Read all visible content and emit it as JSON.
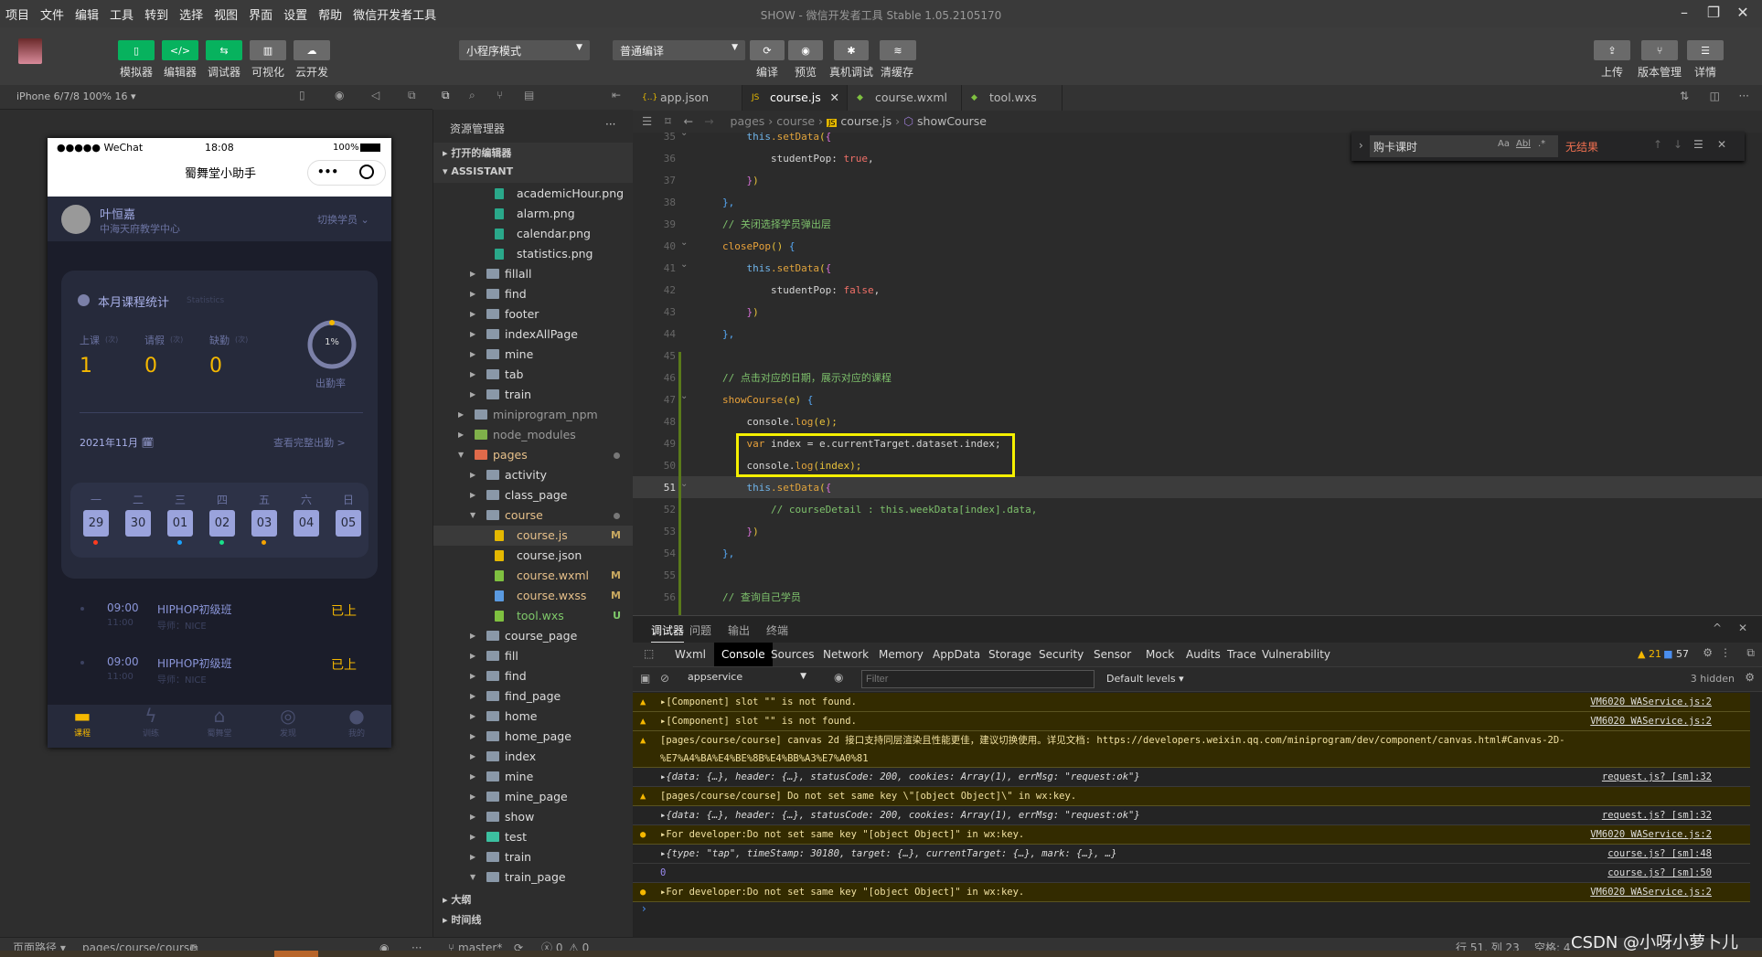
{
  "menu": [
    "项目",
    "文件",
    "编辑",
    "工具",
    "转到",
    "选择",
    "视图",
    "界面",
    "设置",
    "帮助",
    "微信开发者工具"
  ],
  "window_title": "SHOW - 微信开发者工具 Stable 1.05.2105170",
  "toolbar": {
    "left": [
      {
        "label": "模拟器",
        "icon": "phone-icon"
      },
      {
        "label": "编辑器",
        "icon": "code-icon"
      },
      {
        "label": "调试器",
        "icon": "debug-icon"
      },
      {
        "label": "可视化",
        "icon": "layout-icon"
      },
      {
        "label": "云开发",
        "icon": "cloud-icon"
      }
    ],
    "mode_select": "小程序模式",
    "compile_select": "普通编译",
    "mid": [
      {
        "label": "编译",
        "icon": "refresh-icon"
      },
      {
        "label": "预览",
        "icon": "eye-icon"
      },
      {
        "label": "真机调试",
        "icon": "bug-icon"
      },
      {
        "label": "清缓存",
        "icon": "layers-icon"
      }
    ],
    "right": [
      {
        "label": "上传",
        "icon": "upload-icon"
      },
      {
        "label": "版本管理",
        "icon": "branch-icon"
      },
      {
        "label": "详情",
        "icon": "menu-icon"
      }
    ]
  },
  "simulator": {
    "device": "iPhone 6/7/8 100% 16 ▾"
  },
  "phone": {
    "carrier": "●●●●● WeChat",
    "time": "18:08",
    "battery": "100%",
    "app_title": "蜀舞堂小助手",
    "menu_dots": "•••",
    "user": {
      "name": "叶恒嘉",
      "center": "中海天府教学中心",
      "switch": "切换学员"
    },
    "stats": {
      "title": "本月课程统计",
      "subtitle": "Statistics",
      "items": [
        {
          "label": "上课",
          "unit": "(次)",
          "value": "1"
        },
        {
          "label": "请假",
          "unit": "(次)",
          "value": "0"
        },
        {
          "label": "缺勤",
          "unit": "(次)",
          "value": "0"
        }
      ],
      "rate": "1%",
      "rate_label": "出勤率",
      "rate_value": 0.01
    },
    "month": "2021年11月",
    "full_link": "查看完整出勤 >",
    "weekdays": [
      "一",
      "二",
      "三",
      "四",
      "五",
      "六",
      "日"
    ],
    "dates": [
      {
        "d": "29",
        "dot": "#ff3b1f"
      },
      {
        "d": "30",
        "dot": ""
      },
      {
        "d": "01",
        "dot": "#1aa3ff"
      },
      {
        "d": "02",
        "dot": "#19e08a"
      },
      {
        "d": "03",
        "dot": "#f5a300"
      },
      {
        "d": "04",
        "dot": ""
      },
      {
        "d": "05",
        "dot": ""
      }
    ],
    "courses": [
      {
        "start": "09:00",
        "end": "11:00",
        "name": "HIPHOP初级班",
        "teacher": "导师：NICE",
        "status": "已上"
      },
      {
        "start": "09:00",
        "end": "11:00",
        "name": "HIPHOP初级班",
        "teacher": "导师：NICE",
        "status": "已上"
      }
    ],
    "tabbar": [
      "课程",
      "训练",
      "蜀舞堂",
      "发现",
      "我的"
    ]
  },
  "explorer": {
    "title": "资源管理器",
    "more": "···",
    "sections": [
      "打开的编辑器",
      "ASSISTANT"
    ],
    "items": [
      {
        "n": "academicHour.png",
        "l": 3,
        "t": "img"
      },
      {
        "n": "alarm.png",
        "l": 3,
        "t": "img"
      },
      {
        "n": "calendar.png",
        "l": 3,
        "t": "img"
      },
      {
        "n": "statistics.png",
        "l": 3,
        "t": "img"
      },
      {
        "n": "fillall",
        "l": 2,
        "t": "dir"
      },
      {
        "n": "find",
        "l": 2,
        "t": "dir"
      },
      {
        "n": "footer",
        "l": 2,
        "t": "dir"
      },
      {
        "n": "indexAllPage",
        "l": 2,
        "t": "dir"
      },
      {
        "n": "mine",
        "l": 2,
        "t": "dir"
      },
      {
        "n": "tab",
        "l": 2,
        "t": "dir"
      },
      {
        "n": "train",
        "l": 2,
        "t": "dir"
      },
      {
        "n": "miniprogram_npm",
        "l": 1,
        "t": "dir",
        "c": "#999"
      },
      {
        "n": "node_modules",
        "l": 1,
        "t": "npm",
        "c": "#999"
      },
      {
        "n": "pages",
        "l": 1,
        "t": "pages",
        "open": true,
        "c": "#e6c08a",
        "dot": true
      },
      {
        "n": "activity",
        "l": 2,
        "t": "dir"
      },
      {
        "n": "class_page",
        "l": 2,
        "t": "dir"
      },
      {
        "n": "course",
        "l": 2,
        "t": "dir",
        "open": true,
        "c": "#e6c08a",
        "dot": true
      },
      {
        "n": "course.js",
        "l": 3,
        "t": "js",
        "b": "M",
        "c": "#e6c08a",
        "sel": true
      },
      {
        "n": "course.json",
        "l": 3,
        "t": "json"
      },
      {
        "n": "course.wxml",
        "l": 3,
        "t": "wxml",
        "b": "M",
        "c": "#e6c08a"
      },
      {
        "n": "course.wxss",
        "l": 3,
        "t": "wxss",
        "b": "M",
        "c": "#e6c08a"
      },
      {
        "n": "tool.wxs",
        "l": 3,
        "t": "wxs",
        "b": "U",
        "c": "#7fc96a"
      },
      {
        "n": "course_page",
        "l": 2,
        "t": "dir"
      },
      {
        "n": "fill",
        "l": 2,
        "t": "dir"
      },
      {
        "n": "find",
        "l": 2,
        "t": "dir"
      },
      {
        "n": "find_page",
        "l": 2,
        "t": "dir"
      },
      {
        "n": "home",
        "l": 2,
        "t": "dir"
      },
      {
        "n": "home_page",
        "l": 2,
        "t": "dir"
      },
      {
        "n": "index",
        "l": 2,
        "t": "dir"
      },
      {
        "n": "mine",
        "l": 2,
        "t": "dir"
      },
      {
        "n": "mine_page",
        "l": 2,
        "t": "dir"
      },
      {
        "n": "show",
        "l": 2,
        "t": "dir"
      },
      {
        "n": "test",
        "l": 2,
        "t": "test"
      },
      {
        "n": "train",
        "l": 2,
        "t": "dir"
      },
      {
        "n": "train_page",
        "l": 2,
        "t": "dir",
        "open": true
      }
    ],
    "outline": "大纲",
    "timeline": "时间线"
  },
  "tabs": [
    {
      "label": "app.json",
      "icon": "json-icon"
    },
    {
      "label": "course.js",
      "icon": "js-icon",
      "active": true
    },
    {
      "label": "course.wxml",
      "icon": "wxml-icon"
    },
    {
      "label": "tool.wxs",
      "icon": "wxs-icon"
    }
  ],
  "breadcrumb": [
    "pages",
    "course",
    "course.js",
    "showCourse"
  ],
  "find": {
    "query": "购卡课时",
    "opts": [
      "Aa",
      "Abl",
      ".*"
    ],
    "result": "无结果"
  },
  "code": [
    {
      "n": "35",
      "t": [
        [
          "    this",
          "this"
        ],
        [
          ".setData",
          "fn"
        ],
        [
          "(",
          "br2"
        ],
        [
          "{",
          "br"
        ]
      ]
    },
    {
      "n": "36",
      "t": [
        [
          "        studentPop: ",
          "prop"
        ],
        [
          "true",
          "bool"
        ],
        [
          ",",
          "plain"
        ]
      ]
    },
    {
      "n": "37",
      "t": [
        [
          "    ",
          "plain"
        ],
        [
          "}",
          "br"
        ],
        [
          ")",
          "br2"
        ]
      ]
    },
    {
      "n": "38",
      "t": [
        [
          "},",
          "br3"
        ]
      ]
    },
    {
      "n": "39",
      "t": [
        [
          "// 关闭选择学员弹出层",
          "com"
        ]
      ]
    },
    {
      "n": "40",
      "t": [
        [
          "closePop",
          "var"
        ],
        [
          "() ",
          "br2"
        ],
        [
          "{",
          "br3"
        ]
      ]
    },
    {
      "n": "41",
      "t": [
        [
          "    this",
          "this"
        ],
        [
          ".setData",
          "fn"
        ],
        [
          "(",
          "br2"
        ],
        [
          "{",
          "br"
        ]
      ]
    },
    {
      "n": "42",
      "t": [
        [
          "        studentPop: ",
          "prop"
        ],
        [
          "false",
          "bool"
        ],
        [
          ",",
          "plain"
        ]
      ]
    },
    {
      "n": "43",
      "t": [
        [
          "    ",
          "plain"
        ],
        [
          "}",
          "br"
        ],
        [
          ")",
          "br2"
        ]
      ]
    },
    {
      "n": "44",
      "t": [
        [
          "},",
          "br3"
        ]
      ]
    },
    {
      "n": "45",
      "t": []
    },
    {
      "n": "46",
      "t": [
        [
          "// 点击对应的日期，展示对应的课程",
          "com"
        ]
      ]
    },
    {
      "n": "47",
      "t": [
        [
          "showCourse",
          "var"
        ],
        [
          "(e) ",
          "br2"
        ],
        [
          "{",
          "br3"
        ]
      ]
    },
    {
      "n": "48",
      "t": [
        [
          "    console.",
          "plain"
        ],
        [
          "log",
          "fn"
        ],
        [
          "(e);",
          "br2"
        ]
      ]
    },
    {
      "n": "49",
      "t": [
        [
          "    var",
          "var"
        ],
        [
          " index = e.currentTarget.dataset.index;",
          "plain"
        ]
      ]
    },
    {
      "n": "50",
      "t": [
        [
          "    console.",
          "plain"
        ],
        [
          "log",
          "fn"
        ],
        [
          "(index);",
          "br2"
        ]
      ]
    },
    {
      "n": "51",
      "t": [
        [
          "    this",
          "this"
        ],
        [
          ".setData",
          "fn"
        ],
        [
          "(",
          "br2"
        ],
        [
          "{",
          "br"
        ]
      ]
    },
    {
      "n": "52",
      "t": [
        [
          "        // courseDetail : this.weekData[index].data,",
          "com"
        ]
      ]
    },
    {
      "n": "53",
      "t": [
        [
          "    ",
          "plain"
        ],
        [
          "}",
          "br"
        ],
        [
          ")",
          "br2"
        ]
      ]
    },
    {
      "n": "54",
      "t": [
        [
          "},",
          "br3"
        ]
      ]
    },
    {
      "n": "55",
      "t": []
    },
    {
      "n": "56",
      "t": [
        [
          "// 查询自己学员",
          "com"
        ]
      ]
    }
  ],
  "debug": {
    "panel_tabs": [
      "调试器",
      "问题",
      "输出",
      "终端"
    ],
    "devtools_tabs": [
      "Wxml",
      "Console",
      "Sources",
      "Network",
      "Memory",
      "AppData",
      "Storage",
      "Security",
      "Sensor",
      "Mock",
      "Audits",
      "Trace",
      "Vulnerability"
    ],
    "warn_count": "21",
    "info_count": "57",
    "context": "appservice",
    "filter_placeholder": "Filter",
    "levels": "Default levels ▾",
    "hidden": "3 hidden",
    "logs": [
      {
        "level": "warn",
        "text": "▸[Component] slot \"\" is not found.",
        "src": "VM6020 WAService.js:2"
      },
      {
        "level": "warn",
        "text": "▸[Component] slot \"\" is not found.",
        "src": "VM6020 WAService.js:2"
      },
      {
        "level": "warn",
        "text": "[pages/course/course] canvas 2d 接口支持同层渲染且性能更佳，建议切换使用。详见文档: https://developers.weixin.qq.com/miniprogram/dev/component/canvas.html#Canvas-2D-%E7%A4%BA%E4%BE%8B%E4%BB%A3%E7%A0%81",
        "src": ""
      },
      {
        "level": "log",
        "text": "▸{data: {…}, header: {…}, statusCode: 200, cookies: Array(1), errMsg: \"request:ok\"}",
        "src": "request.js? [sm]:32"
      },
      {
        "level": "warn",
        "text": "[pages/course/course] Do not set same key \\\"[object Object]\\\" in wx:key.",
        "src": ""
      },
      {
        "level": "log",
        "text": "▸{data: {…}, header: {…}, statusCode: 200, cookies: Array(1), errMsg: \"request:ok\"}",
        "src": "request.js? [sm]:32"
      },
      {
        "level": "warn6",
        "text": "▸For developer:Do not set same key \"[object Object]\" in wx:key.",
        "src": "VM6020 WAService.js:2"
      },
      {
        "level": "log",
        "text": "▸{type: \"tap\", timeStamp: 30180, target: {…}, currentTarget: {…}, mark: {…}, …}",
        "src": "course.js? [sm]:48"
      },
      {
        "level": "num",
        "text": "0",
        "src": "course.js? [sm]:50"
      },
      {
        "level": "warn6",
        "text": "▸For developer:Do not set same key \"[object Object]\" in wx:key.",
        "src": "VM6020 WAService.js:2"
      }
    ],
    "prompt": "›"
  },
  "status": {
    "path_label": "页面路径 ▾",
    "path": "pages/course/course",
    "branch": "master*",
    "errors": "ⓧ 0",
    "warnings": "⚠ 0",
    "cursor": "行 51, 列 23",
    "spaces": "空格: 4",
    "watermark": "CSDN @小呀小萝卜儿"
  }
}
